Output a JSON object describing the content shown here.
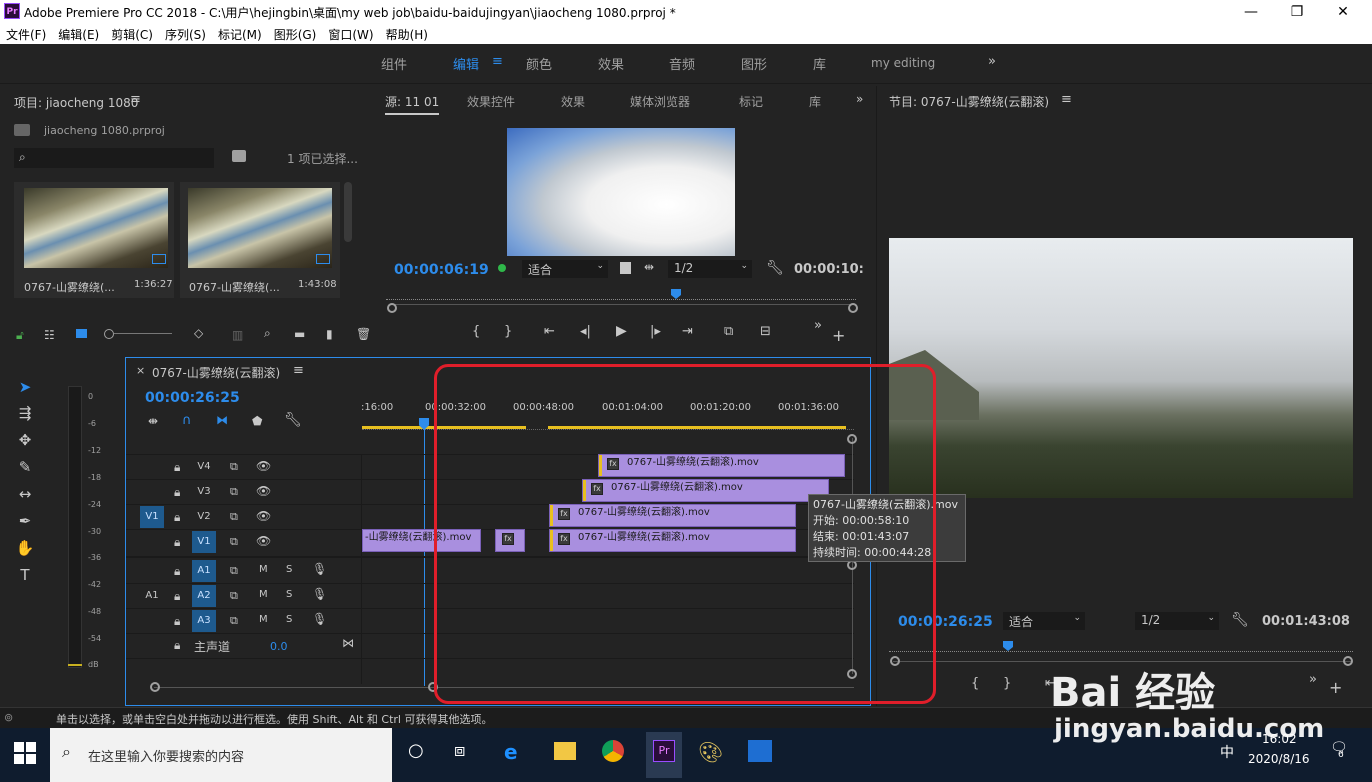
{
  "window": {
    "app_logo": "Pr",
    "title": "Adobe Premiere Pro CC 2018 - C:\\用户\\hejingbin\\桌面\\my web job\\baidu-baidujingyan\\jiaocheng 1080.prproj *"
  },
  "menu": [
    "文件(F)",
    "编辑(E)",
    "剪辑(C)",
    "序列(S)",
    "标记(M)",
    "图形(G)",
    "窗口(W)",
    "帮助(H)"
  ],
  "workspaces": {
    "items": [
      "组件",
      "编辑",
      "颜色",
      "效果",
      "音频",
      "图形",
      "库",
      "my editing"
    ],
    "active": "编辑",
    "more": "»"
  },
  "project": {
    "title": "项目: jiaocheng 1080",
    "file": "jiaocheng 1080.prproj",
    "search_placeholder": "",
    "selection": "1 项已选择...",
    "items": [
      {
        "name": "0767-山雾缭绕(...",
        "duration": "1:36:27"
      },
      {
        "name": "0767-山雾缭绕(...",
        "duration": "1:43:08"
      }
    ]
  },
  "source": {
    "tabs": [
      "源: 11 01",
      "效果控件",
      "效果",
      "媒体浏览器",
      "标记",
      "库"
    ],
    "active_tab": "源: 11 01",
    "timecode": "00:00:06:19",
    "fit": "适合",
    "resolution": "1/2",
    "duration": "00:00:10:"
  },
  "program": {
    "title": "节目: 0767-山雾缭绕(云翻滚)",
    "timecode": "00:00:26:25",
    "fit": "适合",
    "resolution": "1/2",
    "duration": "00:01:43:08"
  },
  "timeline": {
    "sequence": "0767-山雾缭绕(云翻滚)",
    "close": "×",
    "timecode": "00:00:26:25",
    "ruler": [
      ":16:00",
      "00:00:32:00",
      "00:00:48:00",
      "00:01:04:00",
      "00:01:20:00",
      "00:01:36:00"
    ],
    "video_tracks": [
      "V4",
      "V3",
      "V2",
      "V1"
    ],
    "source_patch_video": "V1",
    "source_patch_audio": "A1",
    "audio_tracks": [
      "A1",
      "A2",
      "A3"
    ],
    "mute": "M",
    "solo": "S",
    "master": {
      "label": "主声道",
      "value": "0.0"
    },
    "clip_name": "0767-山雾缭绕(云翻滚).mov",
    "clip_short": "-山雾缭绕(云翻滚).mov",
    "fx_badge": "fx"
  },
  "tooltip": {
    "name": "0767-山雾缭绕(云翻滚).mov",
    "start": "开始: 00:00:58:10",
    "end": "结束: 00:01:43:07",
    "duration": "持续时间: 00:00:44:28"
  },
  "meter": {
    "ticks": [
      "0",
      "-6",
      "-12",
      "-18",
      "-24",
      "-30",
      "-36",
      "-42",
      "-48",
      "-54",
      "dB"
    ]
  },
  "status": "单击以选择，或单击空白处并拖动以进行框选。使用 Shift、Alt 和 Ctrl 可获得其他选项。",
  "taskbar": {
    "search_placeholder": "在这里输入你要搜索的内容",
    "ime": "中",
    "time": "16:02",
    "date": "2020/8/16",
    "notifications": "6"
  },
  "watermark": {
    "brand": "Bai 经验",
    "url": "jingyan.baidu.com"
  },
  "colors": {
    "accent": "#2d8ceb",
    "clip": "#a98fdf",
    "highlight": "#e01e2a"
  }
}
